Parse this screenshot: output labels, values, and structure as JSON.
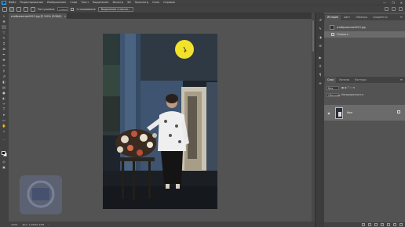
{
  "app": {
    "logo_text": "Ps"
  },
  "menu": [
    "Файл",
    "Редактирование",
    "Изображение",
    "Слои",
    "Текст",
    "Выделение",
    "Фильтр",
    "3D",
    "Просмотр",
    "Окно",
    "Справка"
  ],
  "window_controls": [
    "—",
    "❐",
    "✕"
  ],
  "options_bar": {
    "feather_label": "Растушевка:",
    "feather_value": "0 пикс",
    "antialias_label": "Сглаживание",
    "select_mask_button": "Выделение и маска..."
  },
  "document_tab": {
    "title": "изображение0023.jpg @ 100% (RGB/8)",
    "close": "×"
  },
  "status_bar": {
    "zoom": "100%",
    "doc_info": "Док: 1,20M/1,20M"
  },
  "history_panel": {
    "tabs": [
      "История",
      "Цвет",
      "Образцы",
      "Градиенты"
    ],
    "snapshot_label": "изображение0023.jpg",
    "step_label": "Открыть"
  },
  "layers_panel": {
    "tabs": [
      "Слои",
      "Каналы",
      "Контуры"
    ],
    "filter_label": "Вид",
    "blend_mode": "Обычные",
    "opacity_label": "Непрозрачность:",
    "layer_name": "Фон"
  },
  "colors": {
    "highlight": "#f2e22a",
    "panel_bg": "#535353",
    "chrome": "#424242",
    "canvas_bg": "#20262e"
  }
}
